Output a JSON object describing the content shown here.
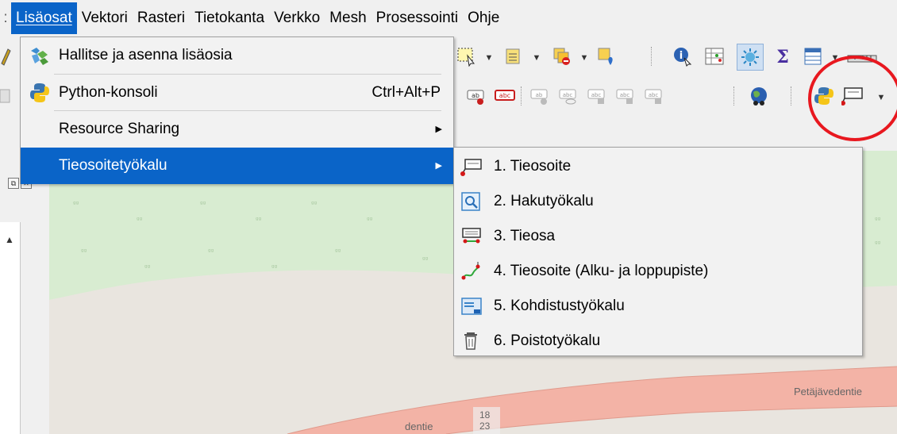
{
  "menubar": {
    "items": [
      {
        "label": "Lisäosat",
        "mnemonic_index": 0
      },
      {
        "label": "Vektori"
      },
      {
        "label": "Rasteri"
      },
      {
        "label": "Tietokanta"
      },
      {
        "label": "Verkko"
      },
      {
        "label": "Mesh"
      },
      {
        "label": "Prosessointi"
      },
      {
        "label": "Ohje"
      }
    ]
  },
  "plugins_menu": {
    "items": [
      {
        "label": "Hallitse ja asenna lisäosia",
        "icon": "puzzle-icon"
      },
      {
        "label": "Python-konsoli",
        "shortcut": "Ctrl+Alt+P",
        "icon": "python-icon"
      },
      {
        "label": "Resource Sharing",
        "has_submenu": true
      },
      {
        "label": "Tieosoitetyökalu",
        "has_submenu": true,
        "highlighted": true
      }
    ]
  },
  "tieosoite_submenu": {
    "items": [
      {
        "label": "1. Tieosoite",
        "icon": "road-address-icon"
      },
      {
        "label": "2. Hakutyökalu",
        "icon": "search-tool-icon"
      },
      {
        "label": "3. Tieosa",
        "icon": "road-section-icon"
      },
      {
        "label": "4. Tieosoite (Alku- ja loppupiste)",
        "icon": "start-end-point-icon"
      },
      {
        "label": "5. Kohdistustyökalu",
        "icon": "targeting-tool-icon"
      },
      {
        "label": "6. Poistotyökalu",
        "icon": "trash-icon"
      }
    ]
  },
  "map": {
    "road_label": "Petäjävedentie",
    "partial_road_label": "dentie",
    "road_number_top": "18",
    "road_number_bottom": "23"
  },
  "colors": {
    "highlight": "#0a64c8",
    "annotation": "#e8181f",
    "road": "#f3b3a6"
  }
}
